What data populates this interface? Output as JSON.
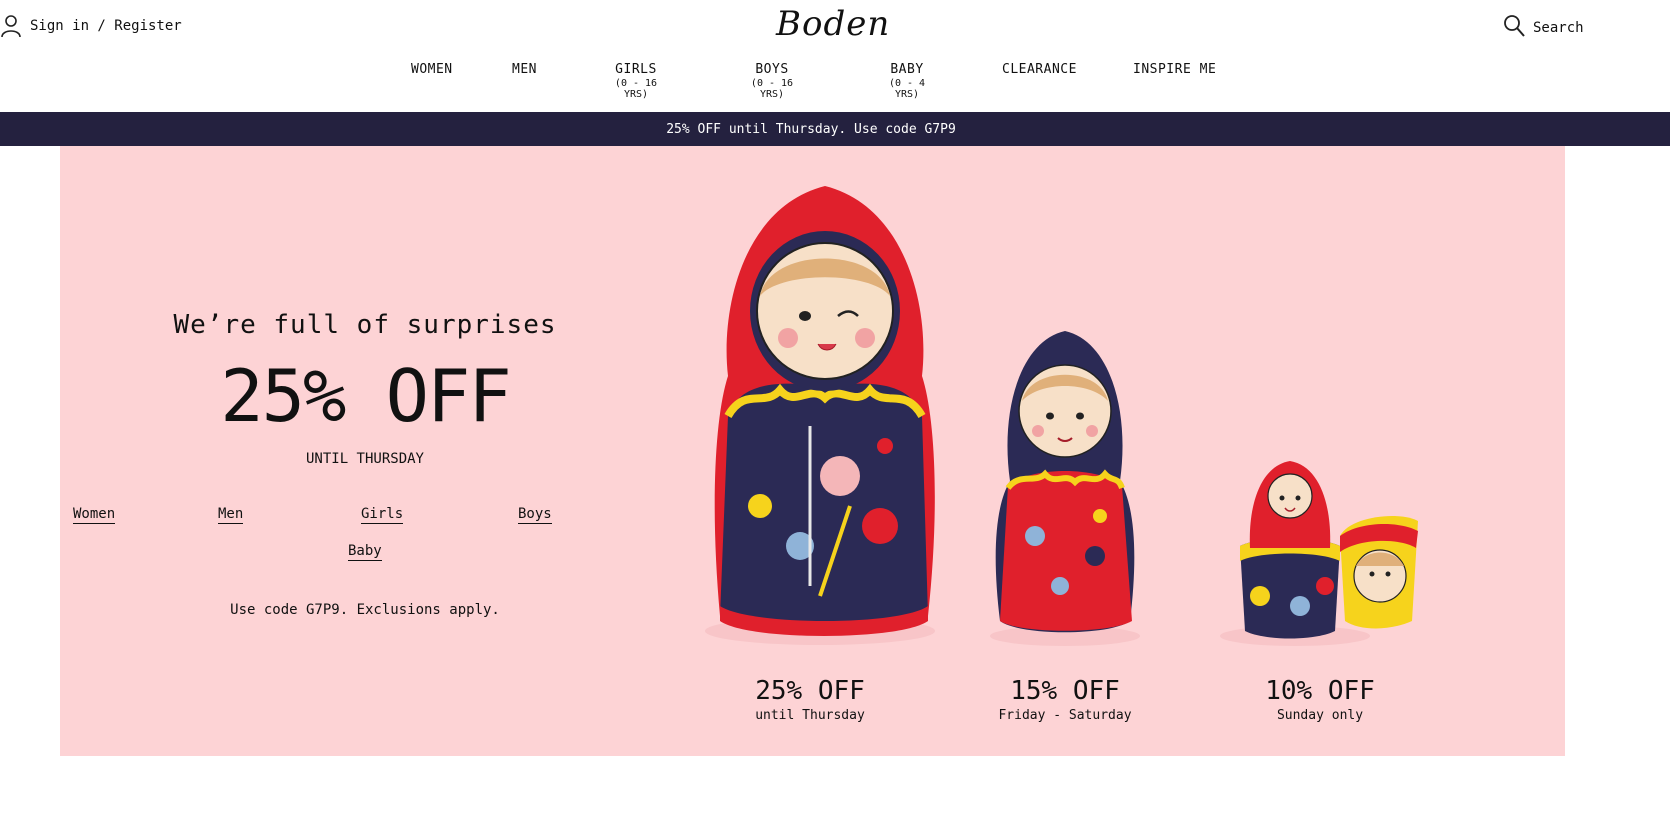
{
  "header": {
    "signin_label": "Sign in / Register",
    "logo_text": "Boden",
    "search_label": "Search"
  },
  "nav": {
    "items": [
      {
        "label": "WOMEN",
        "sub": ""
      },
      {
        "label": "MEN",
        "sub": ""
      },
      {
        "label": "GIRLS",
        "sub": "(0 - 16 YRS)"
      },
      {
        "label": "BOYS",
        "sub": "(0 - 16 YRS)"
      },
      {
        "label": "BABY",
        "sub": "(0 - 4 YRS)"
      },
      {
        "label": "CLEARANCE",
        "sub": ""
      },
      {
        "label": "INSPIRE ME",
        "sub": ""
      }
    ]
  },
  "promo_bar": {
    "text": "25% OFF until Thursday. Use code G7P9"
  },
  "hero": {
    "tagline": "We’re full of surprises",
    "offer": "25% OFF",
    "until": "UNTIL THURSDAY",
    "links": [
      "Women",
      "Men",
      "Girls",
      "Boys",
      "Baby"
    ],
    "code_note": "Use code  G7P9. Exclusions apply.",
    "dolls": [
      {
        "pct": "25% OFF",
        "when": "until Thursday"
      },
      {
        "pct": "15% OFF",
        "when": "Friday - Saturday"
      },
      {
        "pct": "10% OFF",
        "when": "Sunday only"
      }
    ]
  },
  "colors": {
    "promo_bg": "#24213f",
    "hero_bg": "#fdd3d5",
    "doll_red": "#e0202c",
    "doll_navy": "#2b2a55"
  }
}
